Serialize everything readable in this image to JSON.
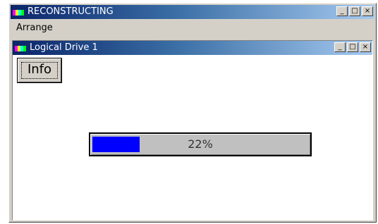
{
  "window": {
    "title": "RECONSTRUCTING",
    "controls": {
      "minimize": "_",
      "maximize": "□",
      "close": "×"
    }
  },
  "menu": {
    "items": [
      "Arrange"
    ]
  },
  "child_window": {
    "title": "Logical Drive 1",
    "controls": {
      "minimize": "_",
      "maximize": "□",
      "close": "×"
    },
    "info_button": "Info"
  },
  "progress": {
    "value": 0.22,
    "label": "22%"
  },
  "colors": {
    "title_bar": "#0a246a",
    "progress_fill": "#0000ff"
  },
  "icons": {
    "app": "raid-app-icon"
  }
}
